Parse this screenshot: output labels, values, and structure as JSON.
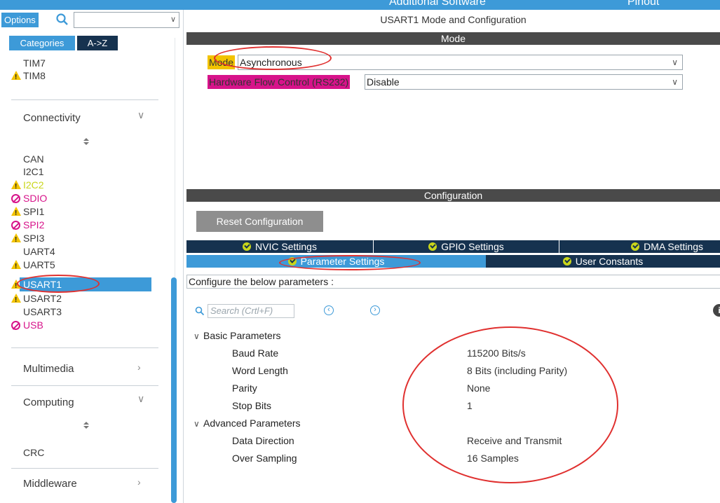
{
  "top_strip": {
    "tab_left": "Additional Software",
    "tab_right": "Pinout"
  },
  "sidebar": {
    "options_label": "Options",
    "search_value": "",
    "categories_label": "Categories",
    "az_label": "A->Z",
    "timers_tail": [
      "TIM7",
      "TIM8"
    ],
    "connectivity": {
      "title": "Connectivity",
      "items": [
        "CAN",
        "I2C1",
        "I2C2",
        "SDIO",
        "SPI1",
        "SPI2",
        "SPI3",
        "UART4",
        "UART5",
        "USART1",
        "USART2",
        "USART3",
        "USB"
      ],
      "selected": "USART1"
    },
    "multimedia": {
      "title": "Multimedia"
    },
    "computing": {
      "title": "Computing",
      "items": [
        "CRC"
      ]
    },
    "middleware": {
      "title": "Middleware"
    }
  },
  "main": {
    "title": "USART1 Mode and Configuration",
    "mode_header": "Mode",
    "mode": {
      "label": "Mode",
      "value": "Asynchronous"
    },
    "flow_control": {
      "label": "Hardware Flow Control (RS232)",
      "value": "Disable"
    },
    "config_header": "Configuration",
    "reset_label": "Reset Configuration",
    "tabs": {
      "nvic": "NVIC Settings",
      "gpio": "GPIO Settings",
      "dma": "DMA Settings",
      "params": "Parameter Settings",
      "constants": "User Constants"
    },
    "configure_text": "Configure the below parameters :",
    "search_placeholder": "Search (Crtl+F)",
    "basic": {
      "title": "Basic Parameters",
      "params": [
        {
          "name": "Baud Rate",
          "value": "115200 Bits/s"
        },
        {
          "name": "Word Length",
          "value": "8 Bits (including Parity)"
        },
        {
          "name": "Parity",
          "value": "None"
        },
        {
          "name": "Stop Bits",
          "value": "1"
        }
      ]
    },
    "advanced": {
      "title": "Advanced Parameters",
      "params": [
        {
          "name": "Data Direction",
          "value": "Receive and Transmit"
        },
        {
          "name": "Over Sampling",
          "value": "16 Samples"
        }
      ]
    }
  },
  "colors": {
    "accent_blue": "#3d9ad8",
    "dark_navy": "#16324f",
    "warning_yellow": "#f2c300",
    "magenta": "#d7138a",
    "annotation_red": "#e0302f"
  }
}
